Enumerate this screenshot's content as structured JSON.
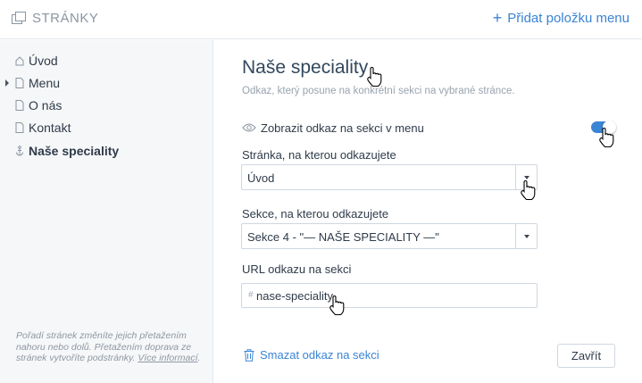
{
  "header": {
    "title": "STRÁNKY",
    "add_item_label": "Přidat položku menu"
  },
  "sidebar": {
    "items": [
      {
        "label": "Úvod",
        "icon": "home-icon"
      },
      {
        "label": "Menu",
        "icon": "page-icon",
        "has_children": true
      },
      {
        "label": "O nás",
        "icon": "page-icon"
      },
      {
        "label": "Kontakt",
        "icon": "page-icon"
      },
      {
        "label": "Naše speciality",
        "icon": "anchor-icon",
        "active": true
      }
    ],
    "help_text_prefix": "Pořadí stránek změníte jejich přetažením nahoru nebo dolů. Přetažením doprava ze stránek vytvoříte podstránky. ",
    "help_link": "Více informací",
    "help_text_suffix": "."
  },
  "panel": {
    "title": "Naše speciality",
    "subtitle": "Odkaz, který posune na konkrétní sekci na vybrané stránce.",
    "toggle": {
      "label": "Zobrazit odkaz na sekci v menu",
      "on": true
    },
    "page_field": {
      "label": "Stránka, na kterou odkazujete",
      "value": "Úvod"
    },
    "section_field": {
      "label": "Sekce, na kterou odkazujete",
      "value": "Sekce 4 - \"— NAŠE SPECIALITY —\""
    },
    "url_field": {
      "label": "URL odkazu na sekci",
      "prefix": "#",
      "value": "nase-speciality"
    },
    "delete_label": "Smazat odkaz na sekci",
    "close_label": "Zavřít"
  },
  "colors": {
    "accent": "#3a84d4",
    "sidebar_bg": "#f6f7f8",
    "border": "#cfd7df"
  }
}
